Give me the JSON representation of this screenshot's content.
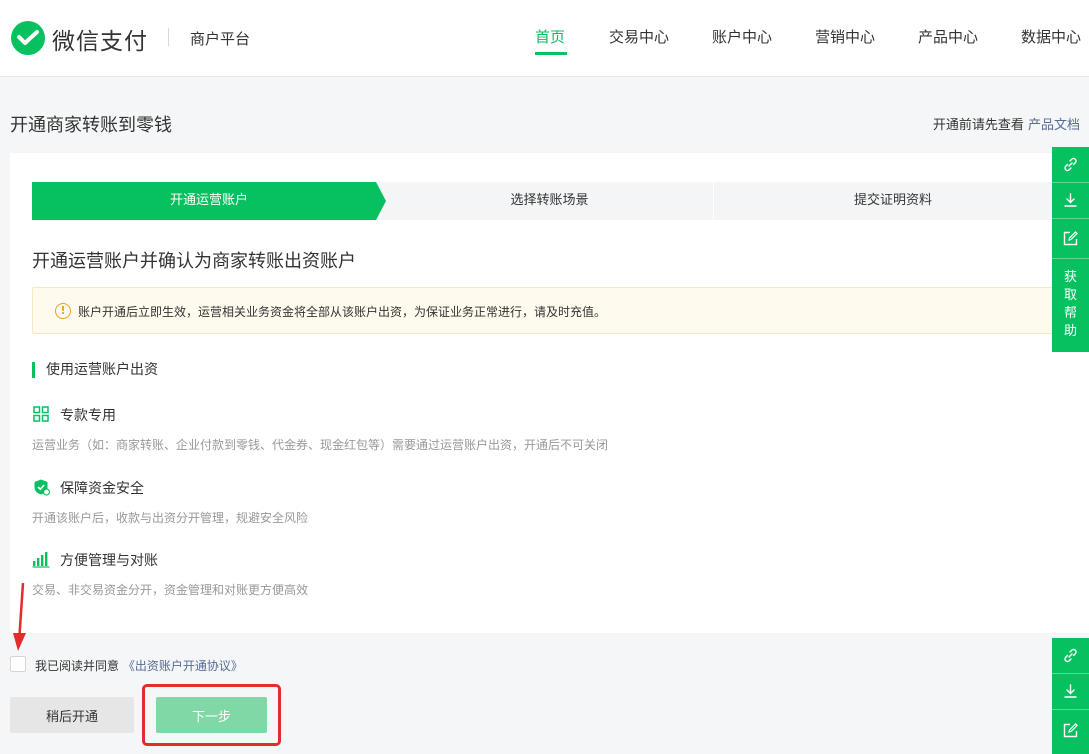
{
  "header": {
    "brand": "微信支付",
    "platform": "商户平台",
    "nav": [
      "首页",
      "交易中心",
      "账户中心",
      "营销中心",
      "产品中心",
      "数据中心"
    ],
    "active_nav": "首页"
  },
  "page": {
    "title": "开通商家转账到零钱",
    "doc_hint": "开通前请先查看",
    "doc_link": "产品文档"
  },
  "steps": [
    "开通运营账户",
    "选择转账场景",
    "提交证明资料"
  ],
  "current_step": 1,
  "section_title": "开通运营账户并确认为商家转账出资账户",
  "alert": {
    "icon": "warning-circle-icon",
    "text": "账户开通后立即生效，运营相关业务资金将全部从该账户出资，为保证业务正常进行，请及时充值。"
  },
  "sub_head": "使用运营账户出资",
  "features": [
    {
      "icon": "grid-icon",
      "title": "专款专用",
      "desc": "运营业务（如：商家转账、企业付款到零钱、代金券、现金红包等）需要通过运营账户出资，开通后不可关闭"
    },
    {
      "icon": "shield-icon",
      "title": "保障资金安全",
      "desc": "开通该账户后，收款与出资分开管理，规避安全风险"
    },
    {
      "icon": "bar-chart-icon",
      "title": "方便管理与对账",
      "desc": "交易、非交易资金分开，资金管理和对账更方便高效"
    }
  ],
  "agreement": {
    "text": "我已阅读并同意",
    "link": "《出资账户开通协议》",
    "checked": false
  },
  "buttons": {
    "later": "稍后开通",
    "next": "下一步"
  },
  "side_toolbar": {
    "help": [
      "获",
      "取",
      "帮",
      "助"
    ]
  },
  "colors": {
    "accent": "#07c160",
    "link": "#576b95",
    "annotation": "#e32c2c"
  }
}
